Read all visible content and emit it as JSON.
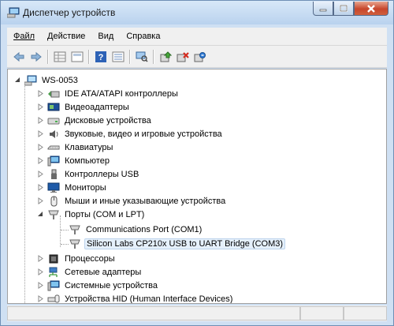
{
  "window": {
    "title": "Диспетчер устройств"
  },
  "menu": [
    {
      "label": "Файл"
    },
    {
      "label": "Действие"
    },
    {
      "label": "Вид"
    },
    {
      "label": "Справка"
    }
  ],
  "toolbar": {
    "icons": [
      "back-arrow-icon",
      "forward-arrow-icon",
      "properties-grid-icon",
      "details-icon",
      "help-icon",
      "list-view-icon",
      "scan-hardware-icon",
      "update-driver-icon",
      "uninstall-icon",
      "disable-device-icon"
    ]
  },
  "tree": {
    "root": "WS-0053",
    "items": [
      {
        "label": "IDE ATA/ATAPI контроллеры",
        "icon": "ide-controller-icon"
      },
      {
        "label": "Видеоадаптеры",
        "icon": "display-adapter-icon"
      },
      {
        "label": "Дисковые устройства",
        "icon": "disk-drive-icon"
      },
      {
        "label": "Звуковые, видео и игровые устройства",
        "icon": "speaker-icon"
      },
      {
        "label": "Клавиатуры",
        "icon": "keyboard-icon"
      },
      {
        "label": "Компьютер",
        "icon": "computer-icon"
      },
      {
        "label": "Контроллеры USB",
        "icon": "usb-icon"
      },
      {
        "label": "Мониторы",
        "icon": "monitor-icon"
      },
      {
        "label": "Мыши и иные указывающие устройства",
        "icon": "mouse-icon"
      },
      {
        "label": "Порты (COM и LPT)",
        "icon": "port-icon",
        "expanded": true,
        "children": [
          {
            "label": "Communications Port (COM1)",
            "icon": "port-icon"
          },
          {
            "label": "Silicon Labs CP210x USB to UART Bridge (COM3)",
            "icon": "port-icon",
            "selected": true
          }
        ]
      },
      {
        "label": "Процессоры",
        "icon": "processor-icon"
      },
      {
        "label": "Сетевые адаптеры",
        "icon": "network-adapter-icon"
      },
      {
        "label": "Системные устройства",
        "icon": "system-device-icon"
      },
      {
        "label": "Устройства HID (Human Interface Devices)",
        "icon": "hid-icon"
      }
    ]
  }
}
